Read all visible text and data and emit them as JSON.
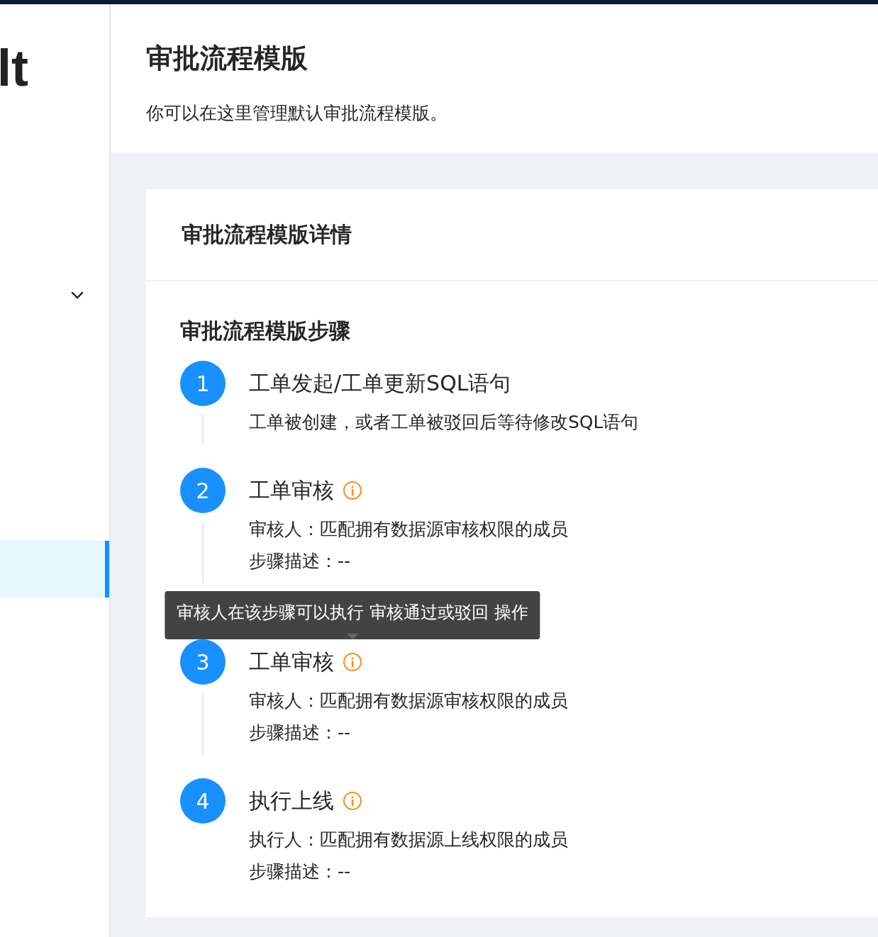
{
  "sidebar": {
    "heading": "lt",
    "menu": [
      {
        "kind": "group",
        "expanded": false
      },
      {
        "kind": "item",
        "selected": true
      }
    ]
  },
  "header": {
    "title": "审批流程模版",
    "description": "你可以在这里管理默认审批流程模版。"
  },
  "card": {
    "title": "审批流程模版详情",
    "section_title": "审批流程模版步骤",
    "steps": [
      {
        "kind": "submit",
        "number": "1",
        "title": "工单发起/工单更新SQL语句",
        "lines": [
          "工单被创建，或者工单被驳回后等待修改SQL语句"
        ]
      },
      {
        "kind": "review",
        "number": "2",
        "title": "工单审核",
        "lines": [
          "审核人：匹配拥有数据源审核权限的成员",
          "步骤描述：--"
        ]
      },
      {
        "kind": "review",
        "number": "3",
        "title": "工单审核",
        "tooltip": "审核人在该步骤可以执行 审核通过或驳回 操作",
        "lines": [
          "审核人：匹配拥有数据源审核权限的成员",
          "步骤描述：--"
        ]
      },
      {
        "kind": "execute",
        "number": "4",
        "title": "执行上线",
        "lines": [
          "执行人：匹配拥有数据源上线权限的成员",
          "步骤描述：--"
        ]
      }
    ]
  }
}
